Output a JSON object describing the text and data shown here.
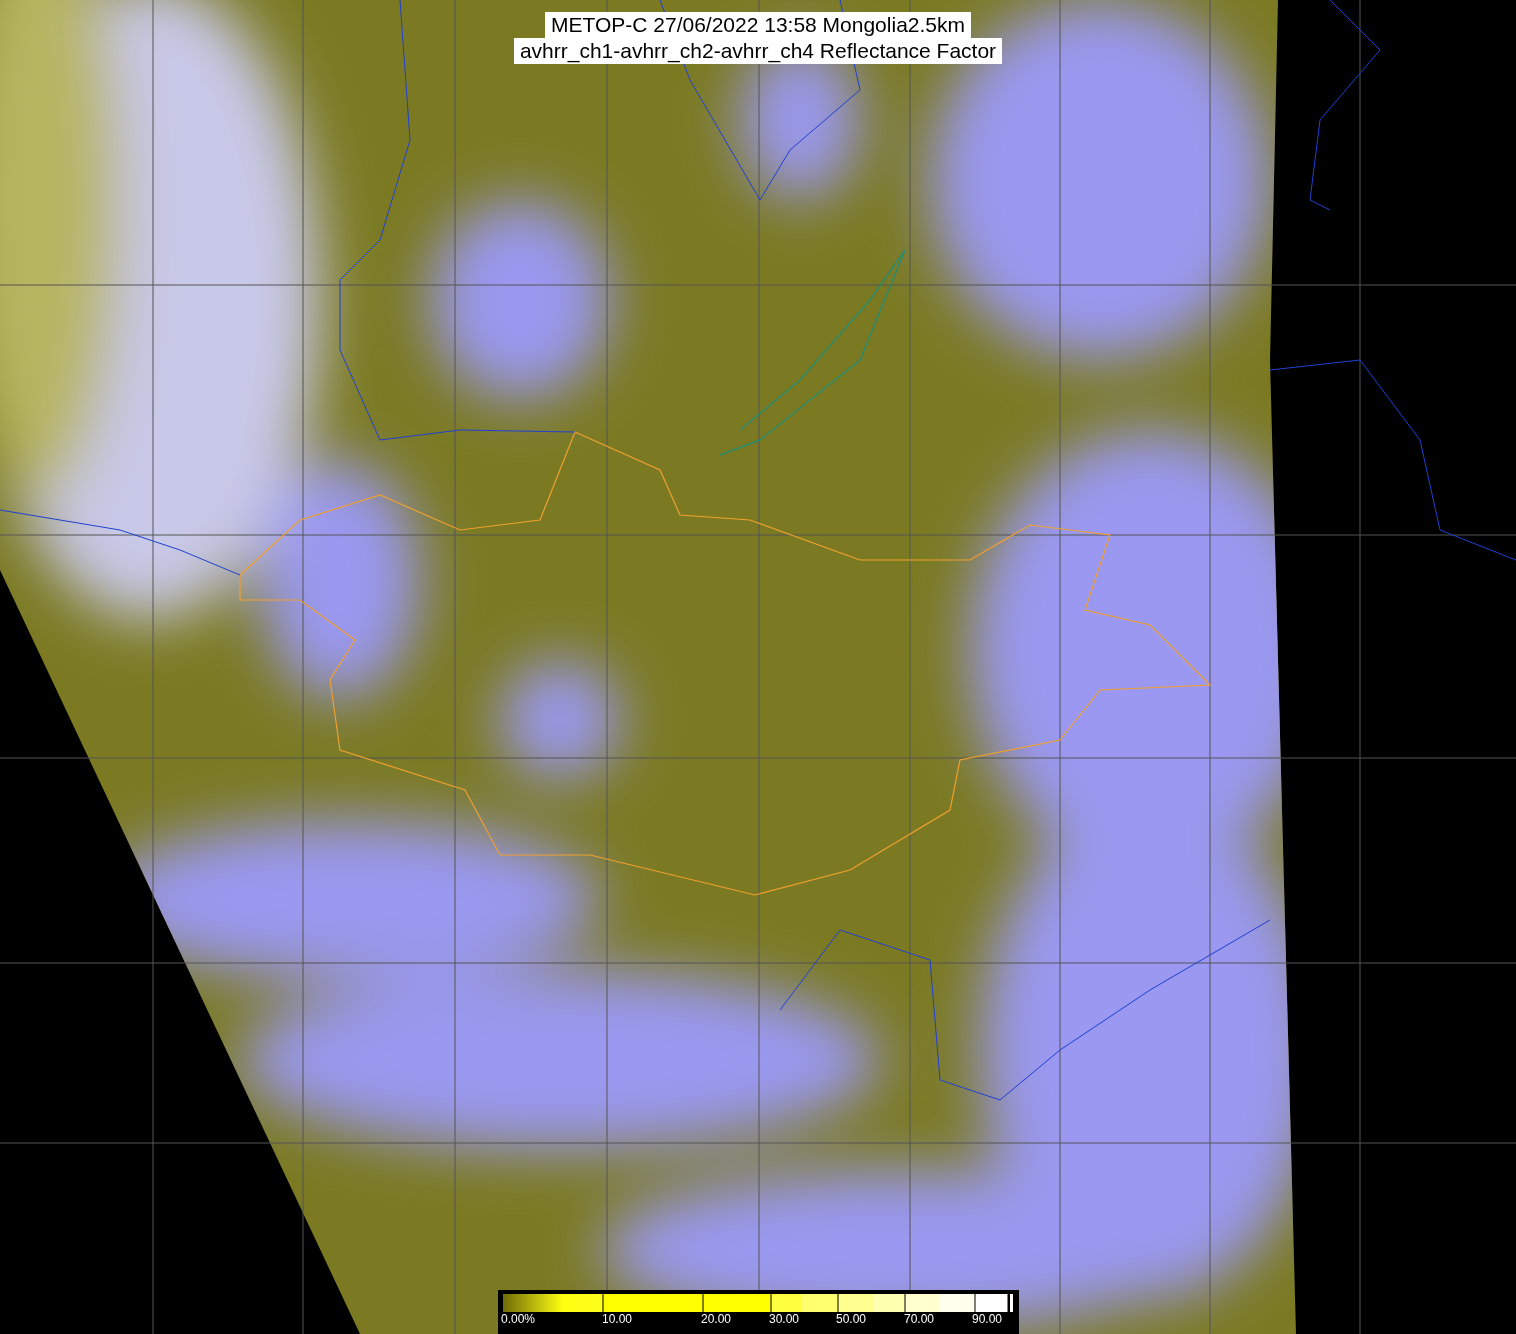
{
  "title": {
    "lines": [
      "METOP-C 27/06/2022 13:58 Mongolia2.5km",
      "avhrr_ch1-avhrr_ch2-avhrr_ch4 Reflectance Factor"
    ]
  },
  "color_scale": {
    "labels": [
      "0.00%",
      "10.00",
      "20.00",
      "30.00",
      "50.00",
      "70.00",
      "90.00"
    ]
  }
}
